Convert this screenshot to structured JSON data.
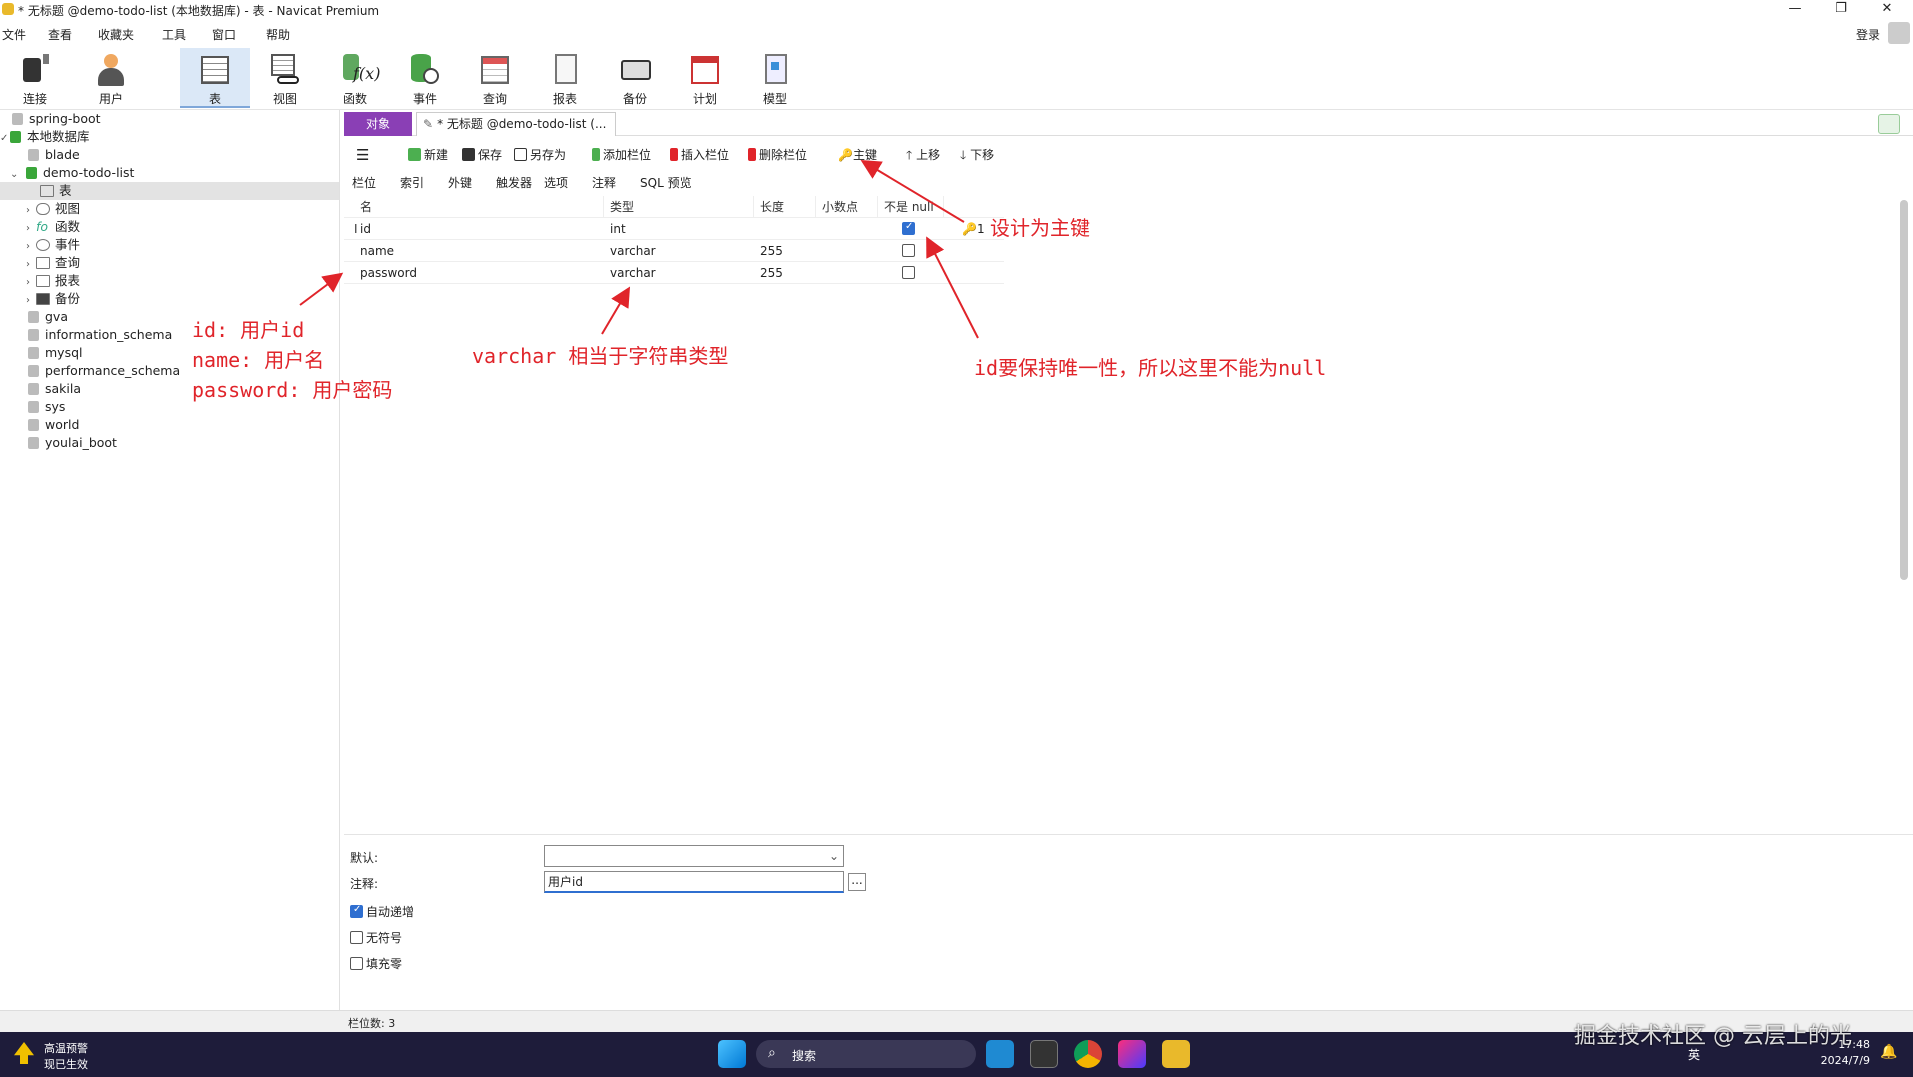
{
  "window": {
    "title": "* 无标题 @demo-todo-list (本地数据库) - 表 - Navicat Premium",
    "minimize": "—",
    "maximize": "❐",
    "close": "✕"
  },
  "menu": [
    "文件",
    "查看",
    "收藏夹",
    "工具",
    "窗口",
    "帮助"
  ],
  "login": "登录",
  "toolbar": [
    {
      "label": "连接",
      "icon": "plug-icon"
    },
    {
      "label": "用户",
      "icon": "user-icon"
    },
    {
      "label": "表",
      "icon": "table-icon"
    },
    {
      "label": "视图",
      "icon": "view-icon"
    },
    {
      "label": "函数",
      "icon": "function-icon"
    },
    {
      "label": "事件",
      "icon": "event-icon"
    },
    {
      "label": "查询",
      "icon": "query-icon"
    },
    {
      "label": "报表",
      "icon": "report-icon"
    },
    {
      "label": "备份",
      "icon": "backup-icon"
    },
    {
      "label": "计划",
      "icon": "schedule-icon"
    },
    {
      "label": "模型",
      "icon": "model-icon"
    }
  ],
  "tree": {
    "items": [
      {
        "label": "spring-boot"
      },
      {
        "label": "本地数据库"
      },
      {
        "label": "blade"
      },
      {
        "label": "demo-todo-list"
      },
      {
        "label": "表"
      },
      {
        "label": "视图"
      },
      {
        "label": "函数"
      },
      {
        "label": "事件"
      },
      {
        "label": "查询"
      },
      {
        "label": "报表"
      },
      {
        "label": "备份"
      },
      {
        "label": "gva"
      },
      {
        "label": "information_schema"
      },
      {
        "label": "mysql"
      },
      {
        "label": "performance_schema"
      },
      {
        "label": "sakila"
      },
      {
        "label": "sys"
      },
      {
        "label": "world"
      },
      {
        "label": "youlai_boot"
      }
    ]
  },
  "tabs": {
    "objects": "对象",
    "document": "* 无标题 @demo-todo-list (..."
  },
  "edit_toolbar": {
    "new": "新建",
    "save": "保存",
    "save_as": "另存为",
    "add_field": "添加栏位",
    "insert_field": "插入栏位",
    "delete_field": "删除栏位",
    "primary_key": "主键",
    "move_up": "上移",
    "move_down": "下移"
  },
  "sub_tabs": [
    "栏位",
    "索引",
    "外键",
    "触发器",
    "选项",
    "注释",
    "SQL 预览"
  ],
  "grid": {
    "headers": [
      "名",
      "类型",
      "长度",
      "小数点",
      "不是 null"
    ],
    "rows": [
      {
        "name": "id",
        "type": "int",
        "length": "",
        "decimal": "",
        "not_null": true,
        "key": "1"
      },
      {
        "name": "name",
        "type": "varchar",
        "length": "255",
        "decimal": "",
        "not_null": false,
        "key": ""
      },
      {
        "name": "password",
        "type": "varchar",
        "length": "255",
        "decimal": "",
        "not_null": false,
        "key": ""
      }
    ]
  },
  "annotations": {
    "primary_key": "设计为主键",
    "fields_line1": "id: 用户id",
    "fields_line2": "name: 用户名",
    "fields_line3": "password: 用户密码",
    "varchar": "varchar 相当于字符串类型",
    "not_null": "id要保持唯一性，所以这里不能为null"
  },
  "properties": {
    "default_label": "默认:",
    "default_value": "",
    "comment_label": "注释:",
    "comment_value": "用户id",
    "ellipsis": "...",
    "auto_increment": {
      "label": "自动递增",
      "checked": true
    },
    "unsigned": {
      "label": "无符号",
      "checked": false
    },
    "zerofill": {
      "label": "填充零",
      "checked": false
    }
  },
  "status": {
    "field_count": "栏位数: 3"
  },
  "taskbar": {
    "weather_title": "高温预警",
    "weather_sub": "现已生效",
    "search": "搜索",
    "ime": "英",
    "time": "17:48",
    "date": "2024/7/9"
  },
  "watermark": "掘金技术社区 @ 云层上的光",
  "colors": {
    "accent": "#8a3fb5",
    "annotation": "#e0242a",
    "taskbar": "#1e1c3a"
  }
}
